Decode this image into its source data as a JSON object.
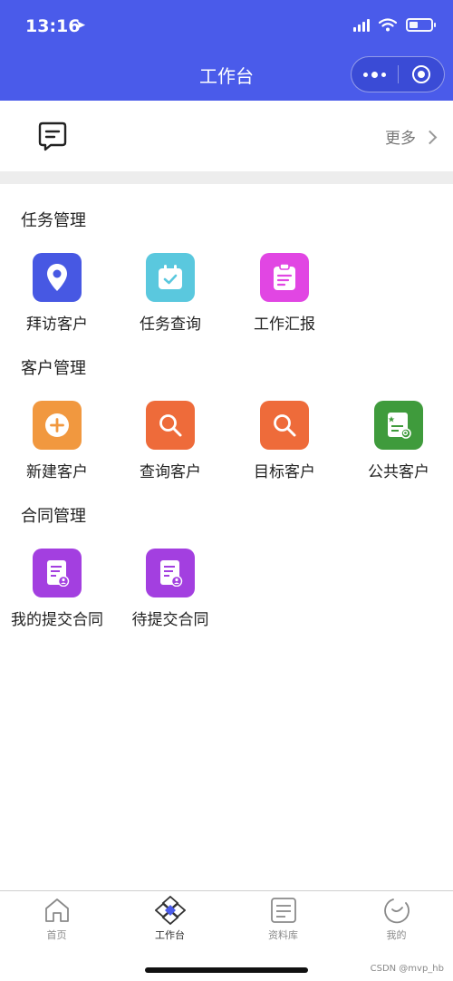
{
  "status_bar": {
    "time": "13:16"
  },
  "header": {
    "title": "工作台"
  },
  "notice": {
    "more_label": "更多"
  },
  "sections": [
    {
      "title": "任务管理",
      "items": [
        {
          "label": "拜访客户",
          "icon": "location-pin-icon",
          "color": "#4758e3"
        },
        {
          "label": "任务查询",
          "icon": "calendar-check-icon",
          "color": "#5ac8de"
        },
        {
          "label": "工作汇报",
          "icon": "report-clipboard-icon",
          "color": "#e146e3"
        }
      ]
    },
    {
      "title": "客户管理",
      "items": [
        {
          "label": "新建客户",
          "icon": "plus-circle-icon",
          "color": "#f1983f"
        },
        {
          "label": "查询客户",
          "icon": "search-icon",
          "color": "#ee6b3a"
        },
        {
          "label": "目标客户",
          "icon": "search-icon",
          "color": "#ee6b3a"
        },
        {
          "label": "公共客户",
          "icon": "public-document-icon",
          "color": "#3f9b3c"
        }
      ]
    },
    {
      "title": "合同管理",
      "items": [
        {
          "label": "我的提交合同",
          "icon": "contract-document-icon",
          "color": "#a33fe0"
        },
        {
          "label": "待提交合同",
          "icon": "contract-document-icon",
          "color": "#a33fe0"
        }
      ]
    }
  ],
  "tabbar": [
    {
      "label": "首页",
      "icon": "home-icon",
      "active": false
    },
    {
      "label": "工作台",
      "icon": "workbench-icon",
      "active": true
    },
    {
      "label": "资料库",
      "icon": "library-icon",
      "active": false
    },
    {
      "label": "我的",
      "icon": "profile-icon",
      "active": false
    }
  ],
  "watermark": "CSDN @mvp_hb"
}
